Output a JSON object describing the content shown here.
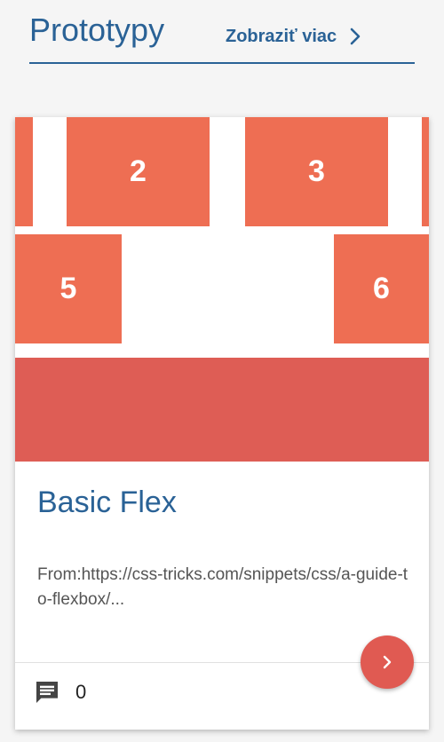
{
  "header": {
    "title": "Prototypy",
    "more_label": "Zobraziť viac"
  },
  "card": {
    "preview_boxes": [
      "2",
      "3",
      "5",
      "6"
    ],
    "title": "Basic Flex",
    "description": "From:https://css-tricks.com/snippets/css/a-guide-to-flexbox/...",
    "comment_count": "0",
    "colors": {
      "box": "#ee6e53",
      "band": "#de5d55",
      "fab": "#e05a52",
      "accent": "#2a6296"
    },
    "icons": {
      "comment": "comment-icon",
      "open": "chevron-right-icon"
    }
  }
}
